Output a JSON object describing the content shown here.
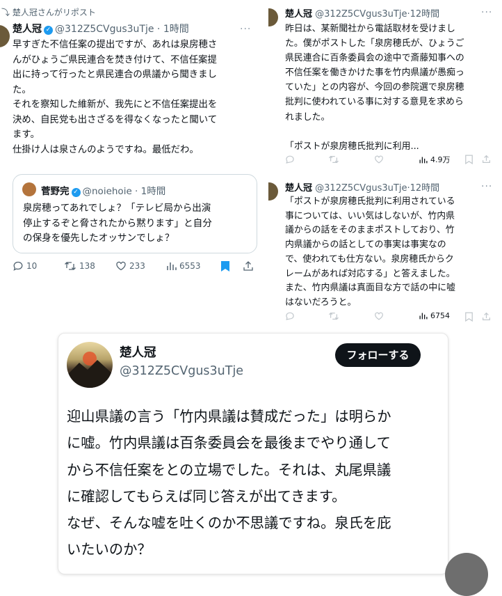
{
  "left": {
    "repost_label": "楚人冠さんがリポスト",
    "author_name": "楚人冠",
    "handle": "@312Z5CVgus3uTje",
    "time": "1時間",
    "body": [
      "早すぎた不信任案の提出ですが、あれは泉房穂さ",
      "んがひょうご県民連合を焚き付けて、不信任案提",
      "出に持って行ったと県民連合の県議から聞きまし",
      "た。",
      "それを察知した維新が、我先にと不信任案提出を",
      "決め、自民党も出さざるを得なくなったと聞いて",
      "ます。",
      "仕掛け人は泉さんのようですね。最低だわ。"
    ],
    "quote": {
      "author_name": "菅野完",
      "handle": "@noiehoie",
      "time": "1時間",
      "body": [
        "泉房穂ってあれでしょ？「テレビ局から出演",
        "停止するぞと脅されたから黙ります」と自分",
        "の保身を優先したオッサンでしょ？"
      ]
    },
    "actions": {
      "replies": "10",
      "reposts": "138",
      "likes": "233",
      "views": "6553"
    }
  },
  "right_top": {
    "author_name": "楚人冠",
    "handle": "@312Z5CVgus3uTje",
    "time": "12時間",
    "body": [
      "昨日は、某新聞社から電話取材を受けまし",
      "た。僕がポストした「泉房穂氏が、ひょうご",
      "県民連合に百条委員会の途中で斎藤知事への",
      "不信任案を働きかけた事を竹内県議が愚痴っ",
      "ていた」との内容が、今回の参院選で泉房穂",
      "批判に使われている事に対する意見を求めら",
      "れました。",
      "",
      "「ポストが泉房穂氏批判に利用..."
    ],
    "views": "4.9万"
  },
  "right_bottom": {
    "author_name": "楚人冠",
    "handle": "@312Z5CVgus3uTje",
    "time": "12時間",
    "body": [
      "「ポストが泉房穂氏批判に利用されている",
      "事については、いい気はしないが、竹内県",
      "議からの話をそのままポストしており、竹",
      "内県議からの話としての事実は事実なの",
      "で、使われても仕方ない。泉房穂氏からク",
      "レームがあれば対応する」と答えました。",
      "また、竹内県議は真面目な方で話の中に嘘",
      "はないだろうと。"
    ],
    "views": "6754"
  },
  "bottom": {
    "author_name": "楚人冠",
    "handle": "@312Z5CVgus3uTje",
    "follow_label": "フォローする",
    "body": [
      "迎山県議の言う「竹内県議は賛成だった」は明らか",
      "に嘘。竹内県議は百条委員会を最後までやり通して",
      "から不信任案をとの立場でした。それは、丸尾県議",
      "に確認してもらえば同じ答えが出てきます。",
      "なぜ、そんな嘘を吐くのか不思議ですね。泉氏を庇",
      "いたいのか？"
    ]
  },
  "colors": {
    "accent": "#1d9bf0",
    "muted": "#536471",
    "text": "#0f1419",
    "bookmark": "#1d9bf0"
  },
  "icons": [
    "repost-icon",
    "verified-badge-icon",
    "more-icon",
    "reply-icon",
    "like-icon",
    "views-icon",
    "bookmark-icon",
    "share-icon"
  ]
}
